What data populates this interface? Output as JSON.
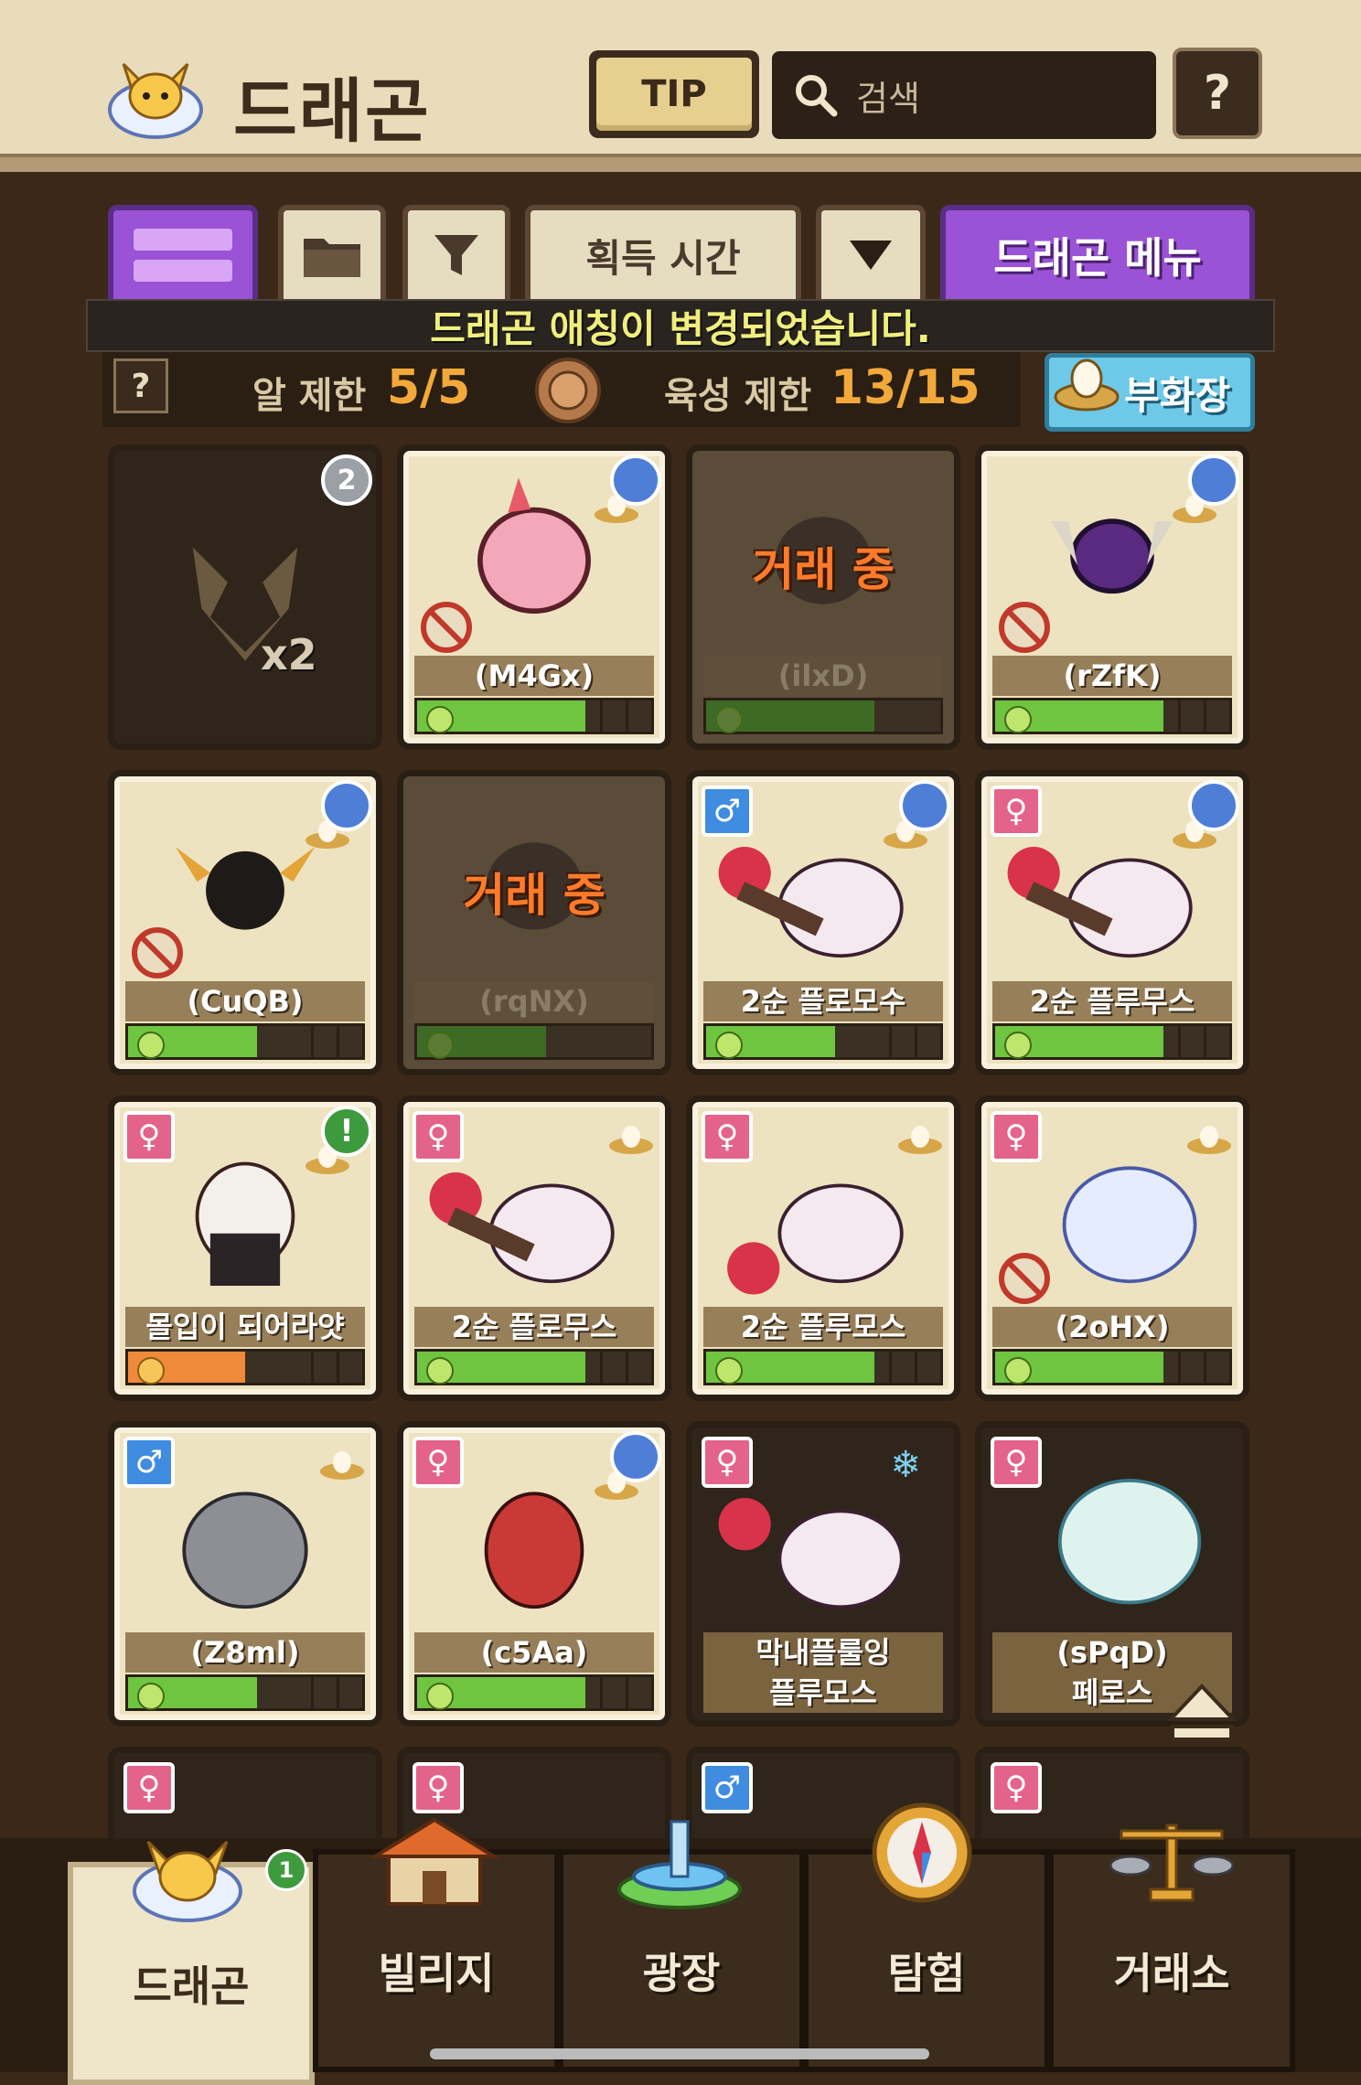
{
  "header": {
    "title": "드래곤",
    "tip_label": "TIP",
    "search_placeholder": "검색",
    "help_label": "?"
  },
  "toolbar": {
    "sort_label": "획득 시간",
    "menu_label": "드래곤 메뉴"
  },
  "toast": "드래곤 애칭이 변경되었습니다.",
  "limits": {
    "help_label": "?",
    "egg_label": "알 제한",
    "egg_value": "5/5",
    "raise_label": "육성 제한",
    "raise_value": "13/15",
    "hatchery_label": "부화장"
  },
  "cards": [
    {
      "name": "",
      "count_label": "x2",
      "corner_badge": "2"
    },
    {
      "name": "(M4Gx)",
      "progress": 0.72
    },
    {
      "name": "(ilxD)",
      "status": "거래 중",
      "progress": 0.72
    },
    {
      "name": "(rZfK)",
      "progress": 0.72
    },
    {
      "name": "(CuQB)",
      "progress": 0.55
    },
    {
      "name": "(rqNX)",
      "status": "거래 중",
      "progress": 0.55
    },
    {
      "name": "2순 플로모수",
      "progress": 0.55
    },
    {
      "name": "2순 플루무스",
      "progress": 0.72
    },
    {
      "name": "몰입이 되어라얏",
      "progress": 0.5,
      "mood": "orange",
      "corner_badge": "!"
    },
    {
      "name": "2순 플로무스",
      "progress": 0.72
    },
    {
      "name": "2순 플루모스",
      "progress": 0.72
    },
    {
      "name": "(2oHX)",
      "progress": 0.72
    },
    {
      "name": "(Z8ml)",
      "progress": 0.55
    },
    {
      "name": "(c5Aa)",
      "progress": 0.72
    },
    {
      "name": "막내플룰잉",
      "subname": "플루모스"
    },
    {
      "name": "(sPqD)",
      "subname": "페로스"
    }
  ],
  "nav": {
    "dragon": "드래곤",
    "village": "빌리지",
    "plaza": "광장",
    "explore": "탐험",
    "market": "거래소",
    "dragon_badge": "1"
  },
  "colors": {
    "accent_purple": "#9a52d6",
    "progress_green": "#6fc540",
    "trade_orange": "#ff7b2a",
    "limit_orange": "#f2a93a"
  }
}
